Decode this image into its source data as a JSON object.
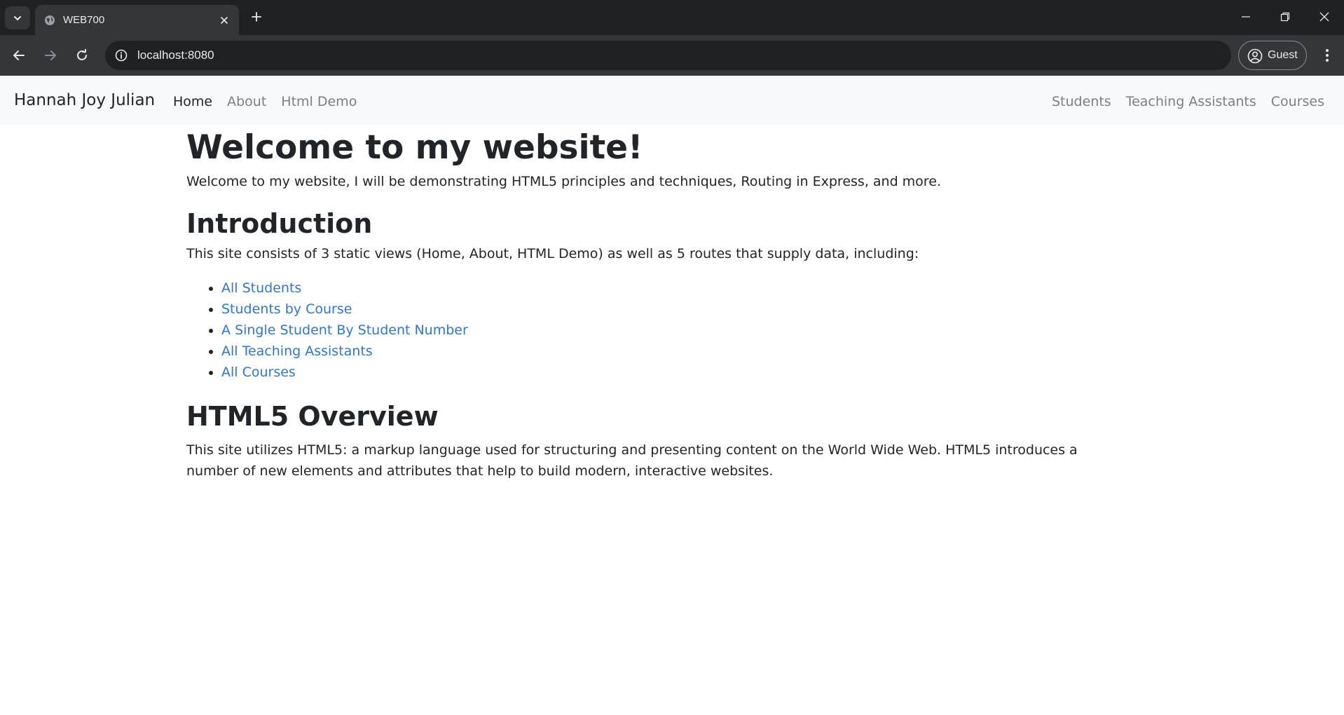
{
  "browser": {
    "tab_title": "WEB700",
    "url": "localhost:8080",
    "profile_label": "Guest"
  },
  "navbar": {
    "brand": "Hannah Joy Julian",
    "left_links": [
      {
        "label": "Home",
        "active": true
      },
      {
        "label": "About",
        "active": false
      },
      {
        "label": "Html Demo",
        "active": false
      }
    ],
    "right_links": [
      {
        "label": "Students"
      },
      {
        "label": "Teaching Assistants"
      },
      {
        "label": "Courses"
      }
    ]
  },
  "main": {
    "title": "Welcome to my website!",
    "intro_text": "Welcome to my website, I will be demonstrating HTML5 principles and techniques, Routing in Express, and more.",
    "section1_heading": "Introduction",
    "section1_text": "This site consists of 3 static views (Home, About, HTML Demo) as well as 5 routes that supply data, including:",
    "routes": [
      "All Students",
      "Students by Course",
      "A Single Student By Student Number",
      "All Teaching Assistants",
      "All Courses"
    ],
    "section2_heading": "HTML5 Overview",
    "section2_text": "This site utilizes HTML5: a markup language used for structuring and presenting content on the World Wide Web. HTML5 introduces a number of new elements and attributes that help to build modern, interactive websites."
  },
  "colors": {
    "link": "#2f76d2",
    "navbar_bg": "#f8f9fa",
    "chrome_dark": "#202124",
    "chrome_toolbar": "#35363a"
  },
  "icons": {
    "tab_search": "chevron-down-icon",
    "favicon": "globe-icon",
    "tab_close": "close-icon",
    "new_tab": "plus-icon",
    "minimize": "minimize-icon",
    "restore": "restore-icon",
    "window_close": "close-icon",
    "back": "back-arrow-icon",
    "forward": "forward-arrow-icon",
    "reload": "reload-icon",
    "site_info": "info-icon",
    "profile": "person-icon",
    "menu": "kebab-menu-icon"
  }
}
